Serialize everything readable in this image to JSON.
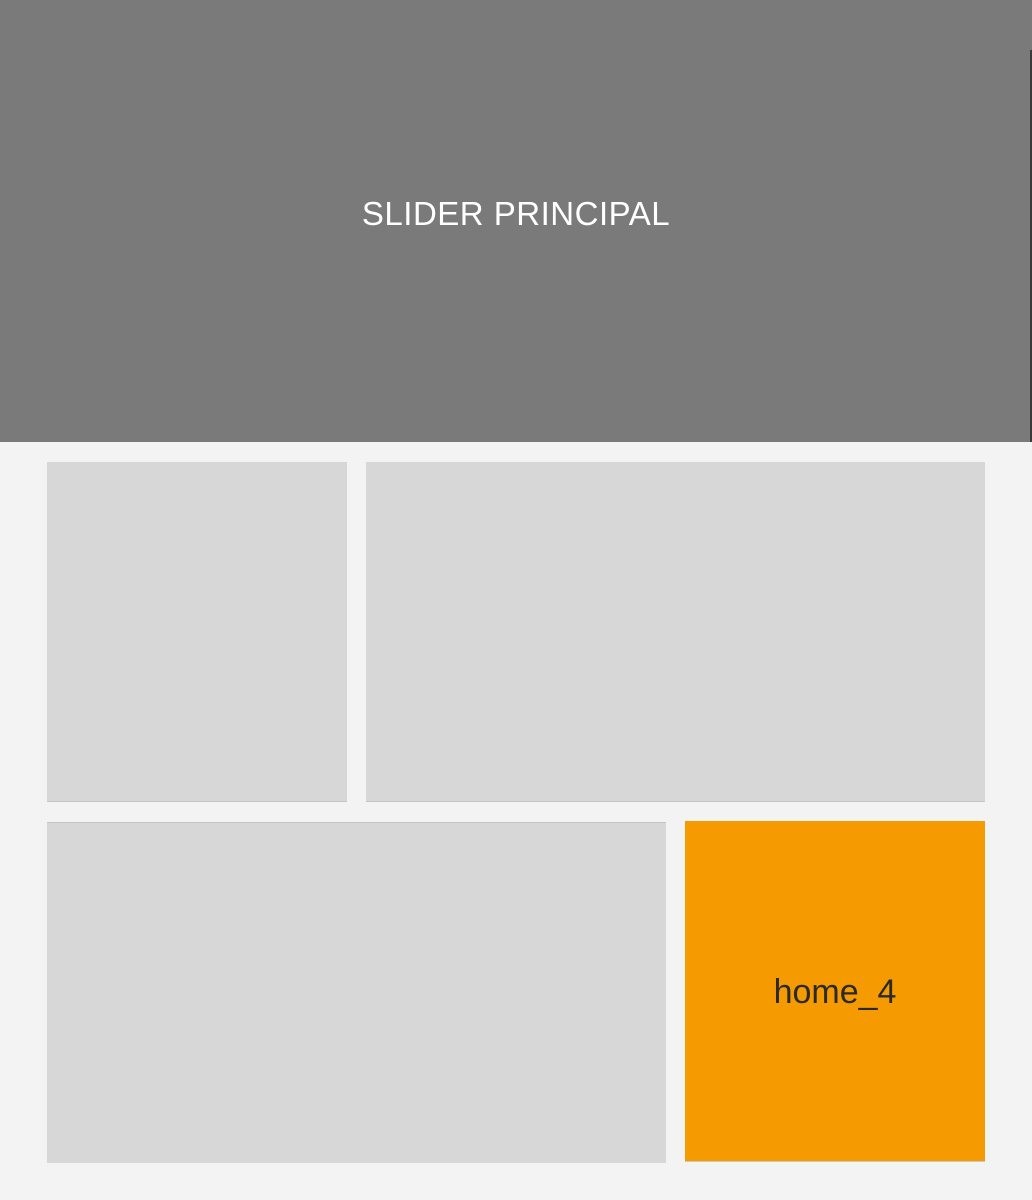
{
  "slider": {
    "label": "SLIDER PRINCIPAL"
  },
  "tiles": [
    {
      "label": ""
    },
    {
      "label": ""
    },
    {
      "label": ""
    },
    {
      "label": "home_4"
    }
  ],
  "colors": {
    "page_background": "#f3f3f3",
    "slider_background": "#7a7a7a",
    "placeholder_tile": "#d7d7d7",
    "accent_tile": "#f59a00",
    "slider_text": "#ffffff",
    "accent_text": "#2a2a2a"
  }
}
